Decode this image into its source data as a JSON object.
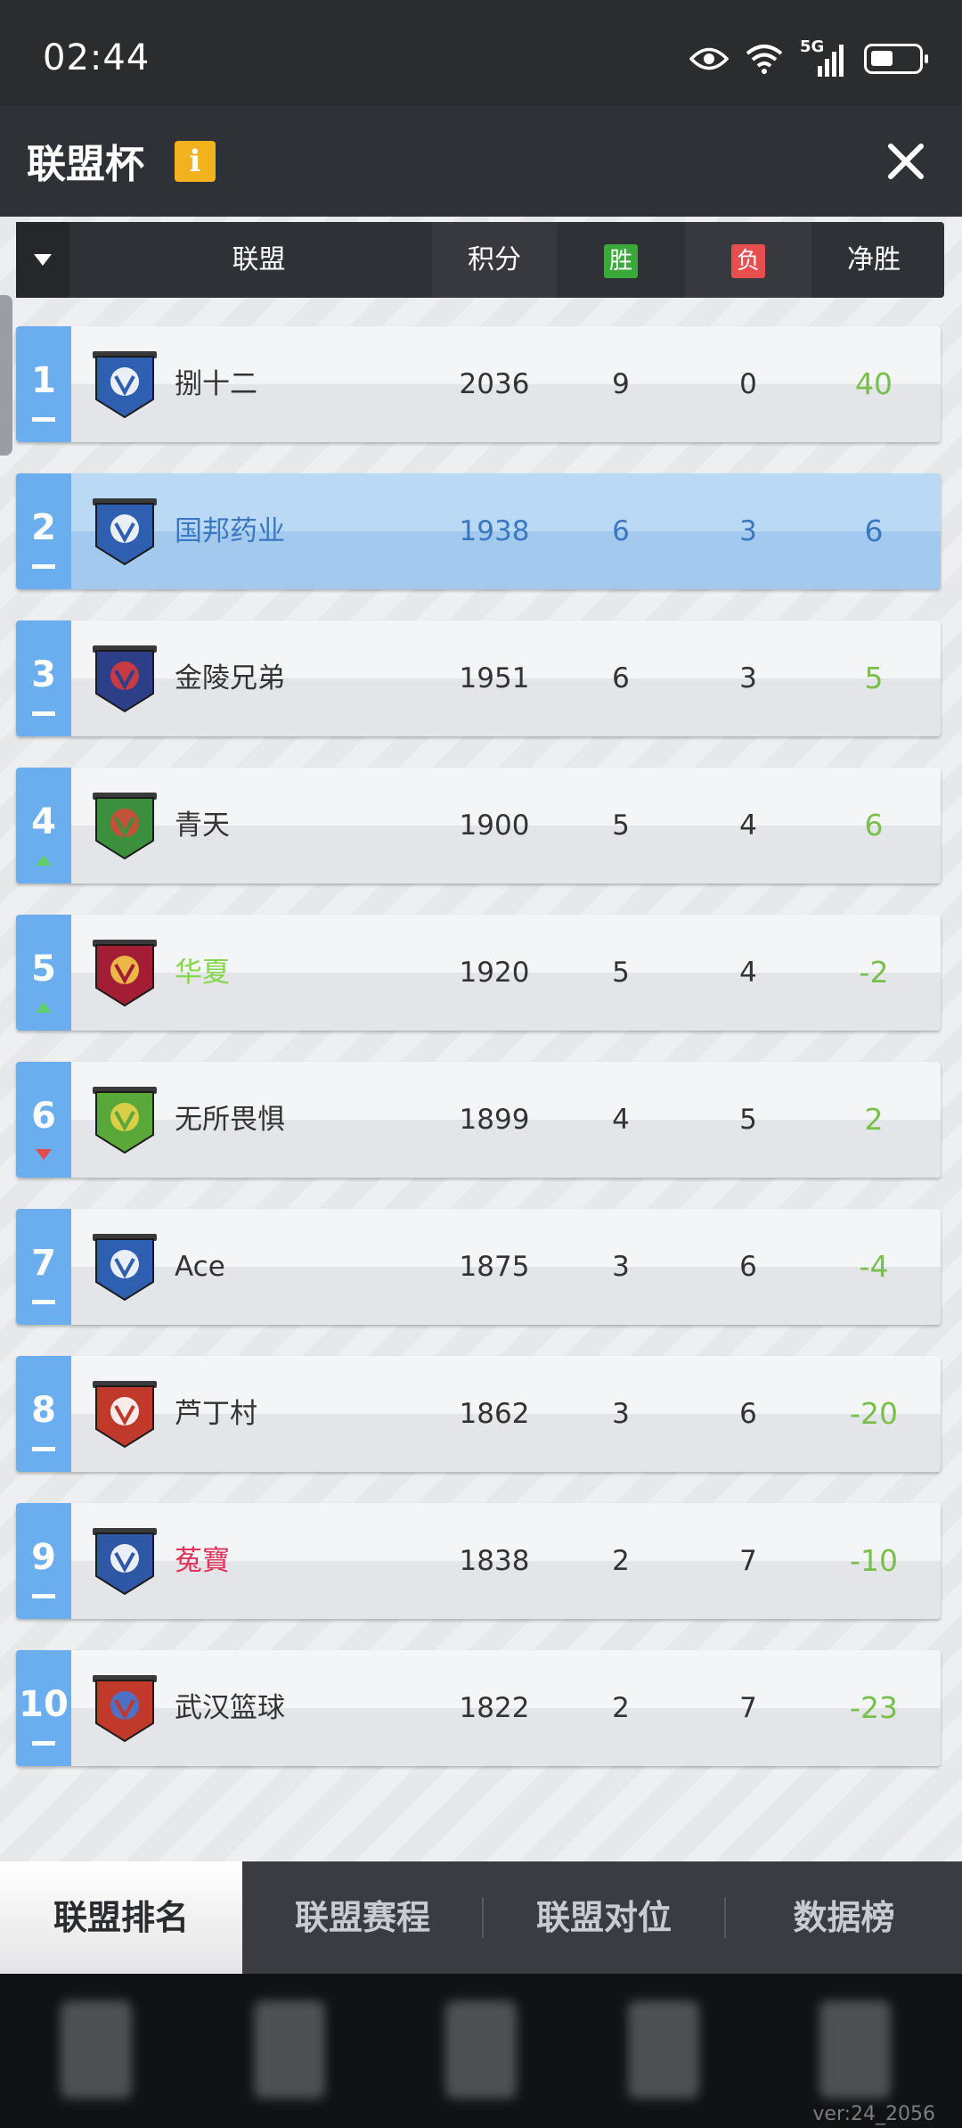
{
  "status_bar": {
    "time": "02:44",
    "network": "5G"
  },
  "title_bar": {
    "title": "联盟杯",
    "info_label": "i"
  },
  "table_header": {
    "alliance": "联盟",
    "points": "积分",
    "wins": "胜",
    "losses": "负",
    "net": "净胜"
  },
  "colors": {
    "win_badge": "#3aa83a",
    "loss_badge": "#e84e4e",
    "rank_bg": "#6aaef0",
    "net_positive": "#79c04a"
  },
  "rows": [
    {
      "rank": "1",
      "trend": "same",
      "name": "捌十二",
      "points": "2036",
      "wins": "9",
      "losses": "0",
      "net": "40",
      "logo": "blue-shield-icon"
    },
    {
      "rank": "2",
      "trend": "same",
      "name": "国邦药业",
      "points": "1938",
      "wins": "6",
      "losses": "3",
      "net": "6",
      "logo": "blue-shield-icon"
    },
    {
      "rank": "3",
      "trend": "same",
      "name": "金陵兄弟",
      "points": "1951",
      "wins": "6",
      "losses": "3",
      "net": "5",
      "logo": "navy-red-shield-icon"
    },
    {
      "rank": "4",
      "trend": "up",
      "name": "青天",
      "points": "1900",
      "wins": "5",
      "losses": "4",
      "net": "6",
      "logo": "green-shield-icon"
    },
    {
      "rank": "5",
      "trend": "up",
      "name": "华夏",
      "points": "1920",
      "wins": "5",
      "losses": "4",
      "net": "-2",
      "logo": "crimson-shield-icon"
    },
    {
      "rank": "6",
      "trend": "down",
      "name": "无所畏惧",
      "points": "1899",
      "wins": "4",
      "losses": "5",
      "net": "2",
      "logo": "green-lion-icon"
    },
    {
      "rank": "7",
      "trend": "same",
      "name": "Ace",
      "points": "1875",
      "wins": "3",
      "losses": "6",
      "net": "-4",
      "logo": "blue-shield-icon"
    },
    {
      "rank": "8",
      "trend": "same",
      "name": "芦丁村",
      "points": "1862",
      "wins": "3",
      "losses": "6",
      "net": "-20",
      "logo": "red-eagle-icon"
    },
    {
      "rank": "9",
      "trend": "same",
      "name": "菟寶",
      "points": "1838",
      "wins": "2",
      "losses": "7",
      "net": "-10",
      "logo": "blue-wing-icon"
    },
    {
      "rank": "10",
      "trend": "same",
      "name": "武汉篮球",
      "points": "1822",
      "wins": "2",
      "losses": "7",
      "net": "-23",
      "logo": "red-blue-shield-icon"
    }
  ],
  "tabs": [
    "联盟排名",
    "联盟赛程",
    "联盟对位",
    "数据榜"
  ],
  "version": "ver:24_2056"
}
